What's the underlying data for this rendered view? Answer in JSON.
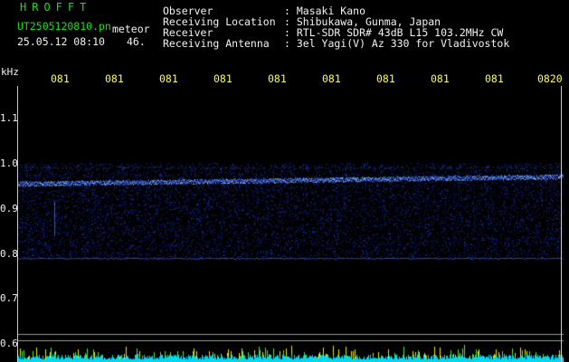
{
  "header": {
    "app_title": "HROFFT",
    "file_name": "UT2505120810.pn",
    "meteor_label": "meteor",
    "date_time": "25.05.12 08:10",
    "count": "46.",
    "info": [
      {
        "label": "Observer",
        "value": ": Masaki Kano"
      },
      {
        "label": "Receiving Location",
        "value": ": Shibukawa, Gunma, Japan"
      },
      {
        "label": "Receiver",
        "value": ": RTL-SDR SDR# 43dB L15 103.2MHz CW"
      },
      {
        "label": "Receiving Antenna",
        "value": ": 3el Yagi(V) Az 330 for Vladivostok"
      }
    ]
  },
  "y_axis": {
    "unit": "kHz",
    "ticks": [
      "1.1",
      "1.0",
      "0.9",
      "0.8",
      "0.7",
      "0.6"
    ]
  },
  "x_axis": {
    "ticks": [
      "081",
      "081",
      "081",
      "081",
      "081",
      "081",
      "081",
      "081",
      "081",
      "0820"
    ]
  },
  "colors": {
    "background": "#000000",
    "text_green": "#16e016",
    "text_white": "#f2f2f2",
    "text_yellow": "#ffff40",
    "echo_blue": "#3a55ff",
    "noise_band_cyan": "#00e5ff"
  }
}
